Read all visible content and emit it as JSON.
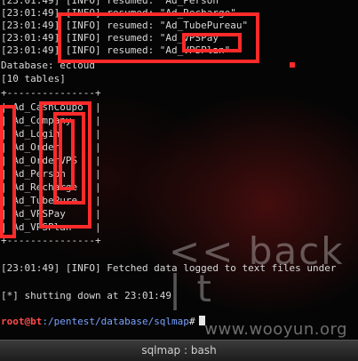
{
  "terminal": {
    "log_lines": [
      "[23:01:49] [INFO] resumed: \"Ad_Person\"",
      "[23:01:49] [INFO] resumed: \"Ad_Recharge\"",
      "[23:01:49] [INFO] resumed: \"Ad_TubePureau\"",
      "[23:01:49] [INFO] resumed: \"Ad_VPSPay\"",
      "[23:01:49] [INFO] resumed: \"Ad_VPSPlan\""
    ],
    "database_line": "Database: ecloud",
    "table_count": "[10 tables]",
    "table_border": "+---------------+",
    "table_rows": [
      "| Ad_CashCoupo  |",
      "| Ad_Company    |",
      "| Ad_Login      |",
      "| Ad_Order      |",
      "| Ad_OrderVPS   |",
      "| Ad_Person     |",
      "| Ad_Recharge   |",
      "| Ad_TubePure   |",
      "| Ad_VPSPay     |",
      "| Ad_VPSPlan    |"
    ],
    "fetched_line": "[23:01:49] [INFO] Fetched data logged to text files under",
    "shutdown_line": "[*] shutting down at 23:01:49",
    "prompt": {
      "user_host": "root@bt",
      "path": ":/pentest/database/sqlmap",
      "symbol": "#"
    }
  },
  "watermarks": {
    "backtrack": "<< back | t",
    "site": "www.wooyun.org"
  },
  "taskbar": {
    "title": "sqlmap : bash"
  },
  "colors": {
    "highlight": "#ff2a2a",
    "prompt_user": "#ff4b4b",
    "prompt_path": "#7aa2ff"
  }
}
